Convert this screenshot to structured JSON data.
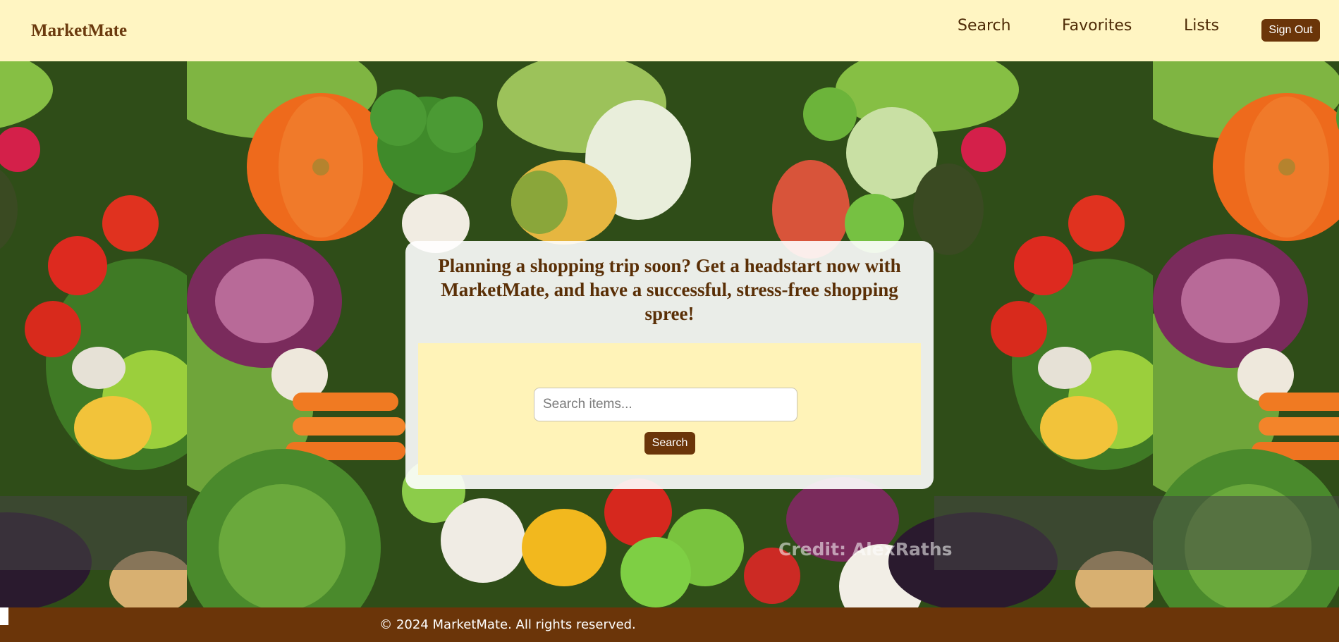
{
  "navbar": {
    "brand": "MarketMate",
    "links": [
      "Search",
      "Favorites",
      "Lists"
    ],
    "signout_label": "Sign Out"
  },
  "hero": {
    "credit": "Credit: AlexRaths",
    "headline": "Planning a shopping trip soon? Get a headstart now with MarketMate, and have a successful, stress-free shopping spree!",
    "search": {
      "placeholder": "Search items...",
      "value": "",
      "button_label": "Search"
    }
  },
  "footer": {
    "text": "© 2024 MarketMate. All rights reserved."
  },
  "colors": {
    "nav_bg": "#fff5c2",
    "brand_brown": "#6b3509",
    "panel_bg": "#fff3b8",
    "headline": "#5a2f06"
  }
}
